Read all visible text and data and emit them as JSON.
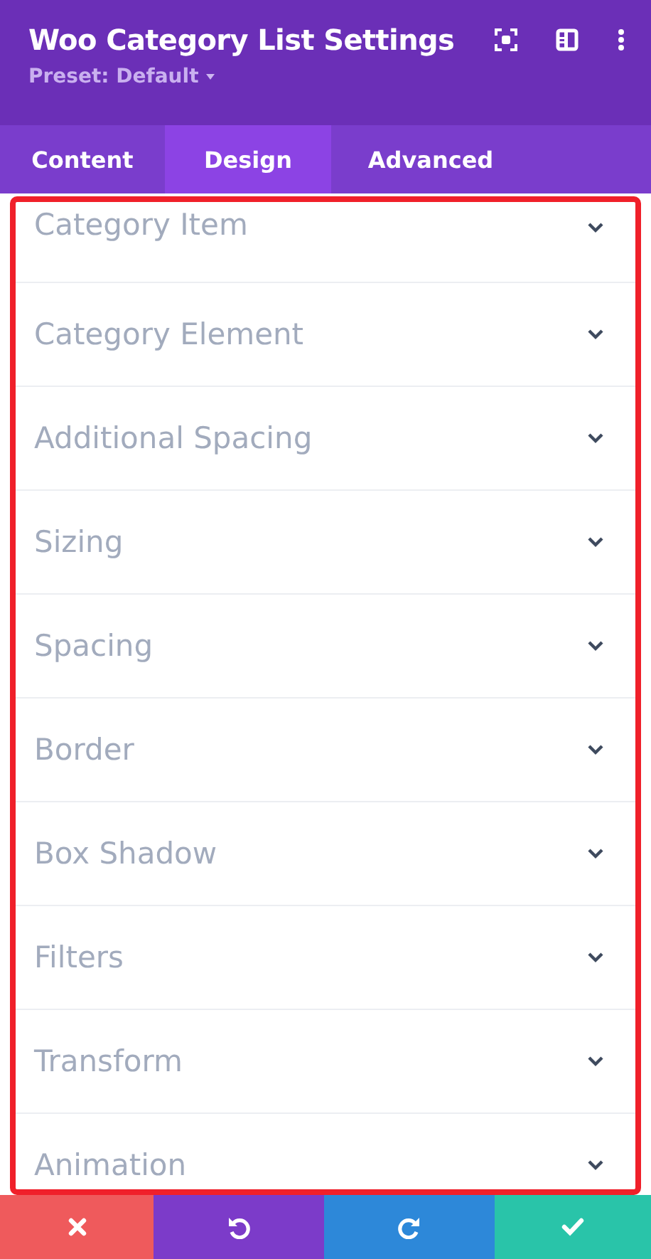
{
  "header": {
    "title": "Woo Category List Settings",
    "preset": "Preset: Default"
  },
  "tabs": [
    {
      "label": "Content",
      "selected": false
    },
    {
      "label": "Design",
      "selected": true
    },
    {
      "label": "Advanced",
      "selected": false
    }
  ],
  "sections": [
    {
      "label": "Category Item",
      "expanded": false
    },
    {
      "label": "Category Element",
      "expanded": false
    },
    {
      "label": "Additional Spacing",
      "expanded": false
    },
    {
      "label": "Sizing",
      "expanded": false
    },
    {
      "label": "Spacing",
      "expanded": false
    },
    {
      "label": "Border",
      "expanded": false
    },
    {
      "label": "Box Shadow",
      "expanded": false
    },
    {
      "label": "Filters",
      "expanded": false
    },
    {
      "label": "Transform",
      "expanded": false
    },
    {
      "label": "Animation",
      "expanded": false
    }
  ],
  "footer_buttons": [
    {
      "kind": "cancel"
    },
    {
      "kind": "undo"
    },
    {
      "kind": "redo"
    },
    {
      "kind": "save"
    }
  ]
}
